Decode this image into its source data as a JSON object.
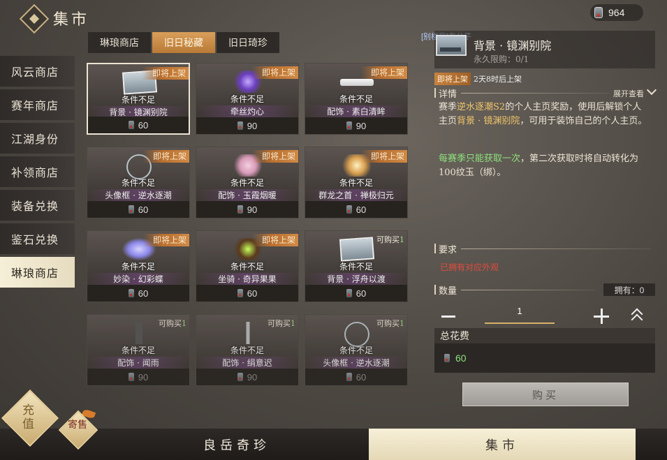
{
  "header": {
    "title": "集市",
    "currency_icon": "jade-coin-icon",
    "currency_amount": "964"
  },
  "sidebar": {
    "items": [
      {
        "label": "风云商店",
        "active": false
      },
      {
        "label": "赛年商店",
        "active": false
      },
      {
        "label": "江湖身份",
        "active": false
      },
      {
        "label": "补领商店",
        "active": false
      },
      {
        "label": "装备兑换",
        "active": false
      },
      {
        "label": "鉴石兑换",
        "active": false
      },
      {
        "label": "琳琅商店",
        "active": true
      }
    ]
  },
  "tabs": [
    {
      "label": "琳琅商店",
      "active": false
    },
    {
      "label": "旧日秘藏",
      "active": true
    },
    {
      "label": "旧日琦珍",
      "active": false
    }
  ],
  "filter_text": "[别楼我]东公子",
  "grid": {
    "items": [
      {
        "badge": "即将上架",
        "condition": "条件不足",
        "name": "背景 · 镜渊别院",
        "price": "60",
        "selected": true,
        "dim": false,
        "art": "landscape-frame-icon"
      },
      {
        "badge": "即将上架",
        "condition": "条件不足",
        "name": "牵丝灼心",
        "price": "90",
        "selected": false,
        "dim": false,
        "art": "purple-flower-icon"
      },
      {
        "badge": "即将上架",
        "condition": "条件不足",
        "name": "配饰 · 素白清眸",
        "price": "90",
        "selected": false,
        "dim": false,
        "art": "blindfold-icon"
      },
      {
        "badge": "即将上架",
        "condition": "条件不足",
        "name": "头像框 · 逆水逐潮",
        "price": "60",
        "selected": false,
        "dim": false,
        "art": "ring-frame-icon"
      },
      {
        "badge": "即将上架",
        "condition": "条件不足",
        "name": "配饰 · 玉霞烟暖",
        "price": "90",
        "selected": false,
        "dim": false,
        "art": "flower-ornament-icon"
      },
      {
        "badge": "即将上架",
        "condition": "条件不足",
        "name": "群龙之首 · 禅极归元",
        "price": "60",
        "selected": false,
        "dim": false,
        "art": "glowing-figure-icon"
      },
      {
        "badge": "即将上架",
        "condition": "条件不足",
        "name": "妙染 · 幻彩蝶",
        "price": "60",
        "selected": false,
        "dim": false,
        "art": "butterfly-icon"
      },
      {
        "badge": "即将上架",
        "condition": "条件不足",
        "name": "坐骑 · 奇异果果",
        "price": "60",
        "selected": false,
        "dim": false,
        "art": "mount-creature-icon"
      },
      {
        "limit_label": "可购买",
        "limit_num": "1",
        "condition": "条件不足",
        "name": "背景 · 浮舟以渡",
        "price": "60",
        "selected": false,
        "dim": false,
        "art": "landscape-frame-icon"
      },
      {
        "limit_label": "可购买",
        "limit_num": "1",
        "condition": "条件不足",
        "name": "配饰 · 闻雨",
        "price": "90",
        "selected": false,
        "dim": true,
        "art": "tassel-ornament-icon"
      },
      {
        "limit_label": "可购买",
        "limit_num": "1",
        "condition": "条件不足",
        "name": "配饰 · 绢意迟",
        "price": "90",
        "selected": false,
        "dim": true,
        "art": "hairpin-icon"
      },
      {
        "limit_label": "可购买",
        "limit_num": "1",
        "condition": "条件不足",
        "name": "头像框 · 逆水逐潮",
        "price": "60",
        "selected": false,
        "dim": true,
        "art": "ring-frame-icon"
      }
    ]
  },
  "detail": {
    "title": "背景 · 镜渊别院",
    "subtitle": "永久限购：0/1",
    "countdown_tag": "即将上架",
    "countdown_text": "2天8时后上架",
    "section_details": "详情",
    "expand_label": "展开查看",
    "desc_part1": "赛季",
    "desc_hl1": "逆水逐潮S2",
    "desc_part2": "的个人主页奖励，使用后解锁个人主页",
    "desc_hl2": "背景 · 镜渊别院",
    "desc_part3": "，可用于装饰自己的个人主页。",
    "desc2_green": "每赛季只能获取一次",
    "desc2_rest": "，第二次获取时将自动转化为100纹玉（绑）。",
    "section_requirements": "要求",
    "requirement_text": "已拥有对应外观",
    "section_quantity": "数量",
    "owned_label": "拥有：0",
    "quantity_value": "1",
    "total_label": "总花费",
    "total_value": "60",
    "buy_label": "购买"
  },
  "bottom_nav": [
    {
      "label": "良岳奇珍",
      "active": false
    },
    {
      "label": "集市",
      "active": true
    }
  ],
  "corner": {
    "charge_label": "充值",
    "consign_label": "寄售"
  },
  "colors": {
    "accent_orange": "#c7833f",
    "green": "#8ee07d",
    "red": "#e24b3e",
    "gold": "#f1c56a"
  }
}
